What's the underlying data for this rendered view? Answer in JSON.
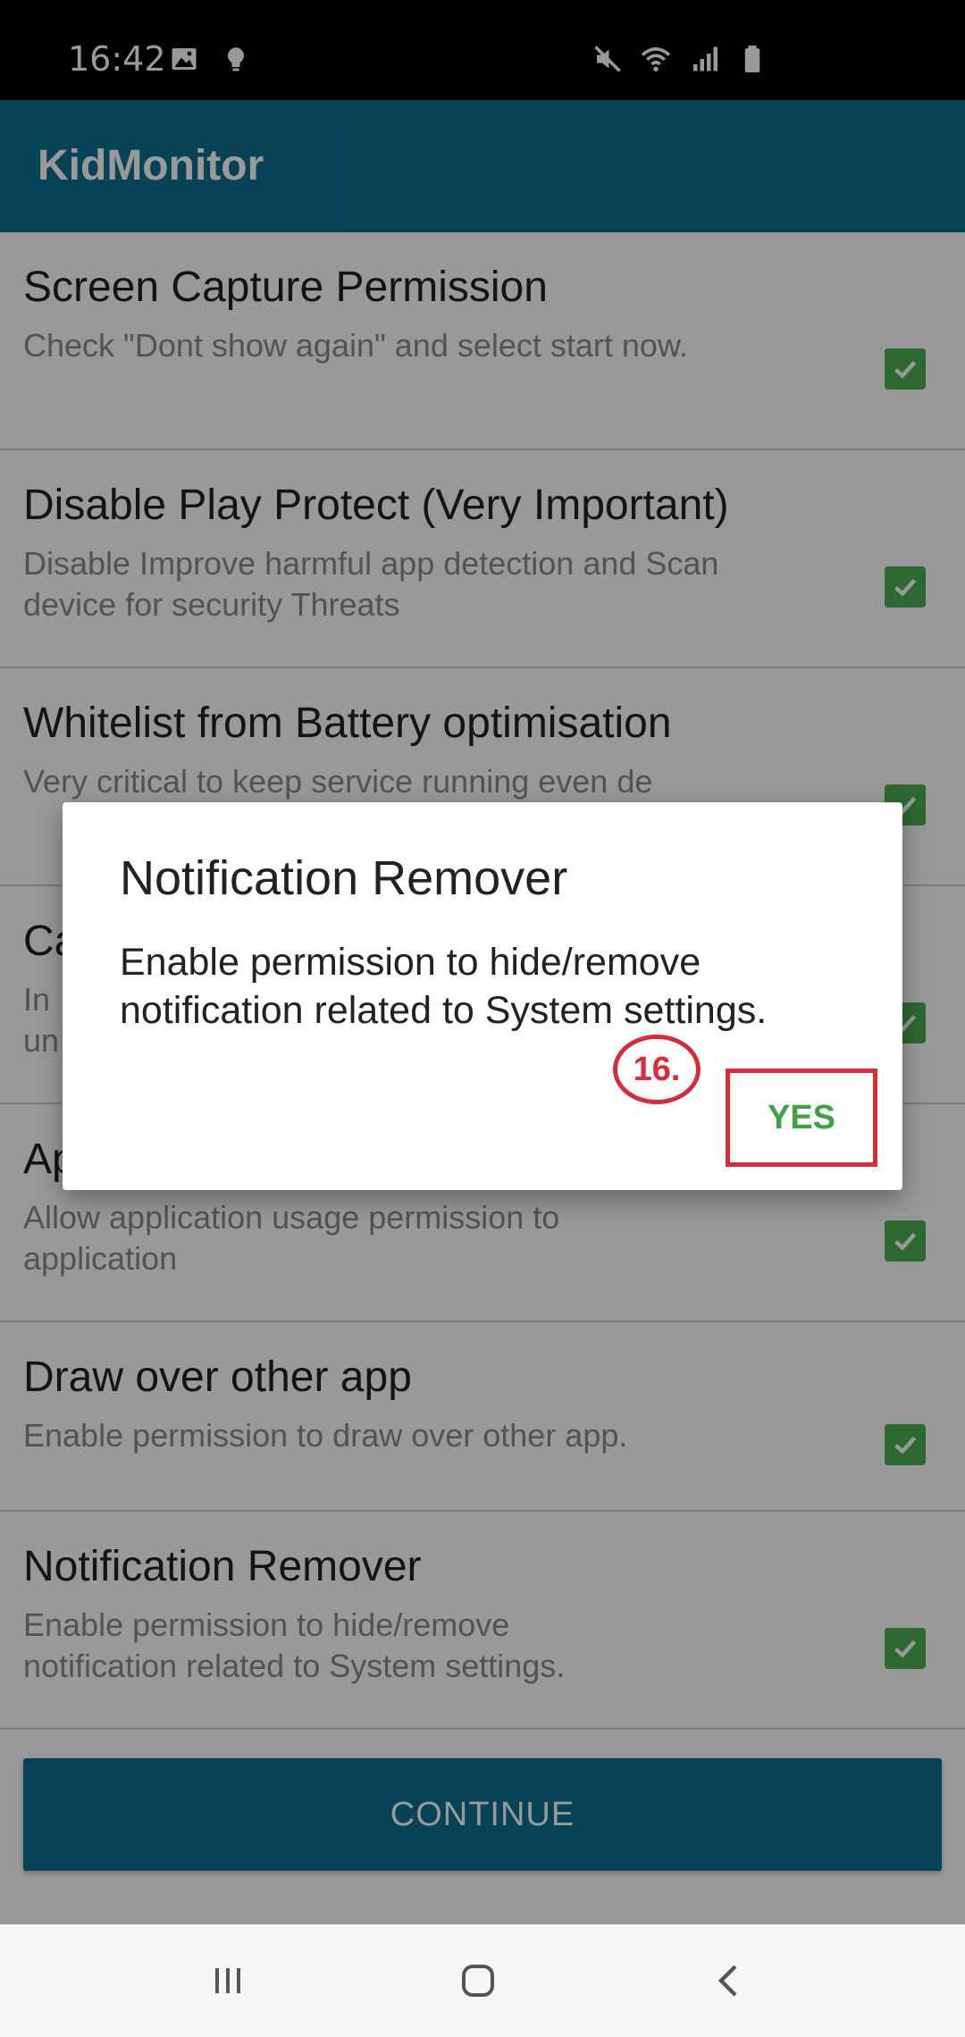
{
  "status_bar": {
    "time": "16:42",
    "left_icons": [
      "image-icon",
      "bulb-icon"
    ],
    "right_icons": [
      "mute-icon",
      "wifi-icon",
      "signal-icon",
      "battery-icon"
    ]
  },
  "app_bar": {
    "title": "KidMonitor",
    "color": "#0d6f8f"
  },
  "settings_list": {
    "items": [
      {
        "title": "Screen Capture Permission",
        "subtitle": "Check \"Dont show again\" and select start now.",
        "checked": true
      },
      {
        "title": "Disable Play Protect (Very Important)",
        "subtitle": "Disable Improve harmful app detection and Scan device for security Threats",
        "checked": true
      },
      {
        "title": "Whitelist from Battery optimisation",
        "subtitle": "Very critical to keep service running even de",
        "checked": true
      },
      {
        "title": "Ca",
        "subtitle": "In un",
        "checked": true
      },
      {
        "title": "Ap",
        "subtitle": "Allow application usage permission to application",
        "checked": true
      },
      {
        "title": "Draw over other app",
        "subtitle": "Enable permission to draw over other app.",
        "checked": true
      },
      {
        "title": "Notification Remover",
        "subtitle": "Enable permission to hide/remove notification related to System settings.",
        "checked": true
      }
    ]
  },
  "continue_button": {
    "label": "CONTINUE"
  },
  "dialog": {
    "title": "Notification Remover",
    "message": "Enable permission to hide/remove notification related to System settings.",
    "yes_label": "YES",
    "step_badge": "16."
  },
  "nav_bar": {
    "buttons": [
      "recent-apps-icon",
      "home-icon",
      "back-icon"
    ]
  },
  "colors": {
    "accent": "#0d6f8f",
    "checkbox": "#4caf50",
    "yes_text": "#43a047",
    "annotation_red": "#d32f3a"
  }
}
